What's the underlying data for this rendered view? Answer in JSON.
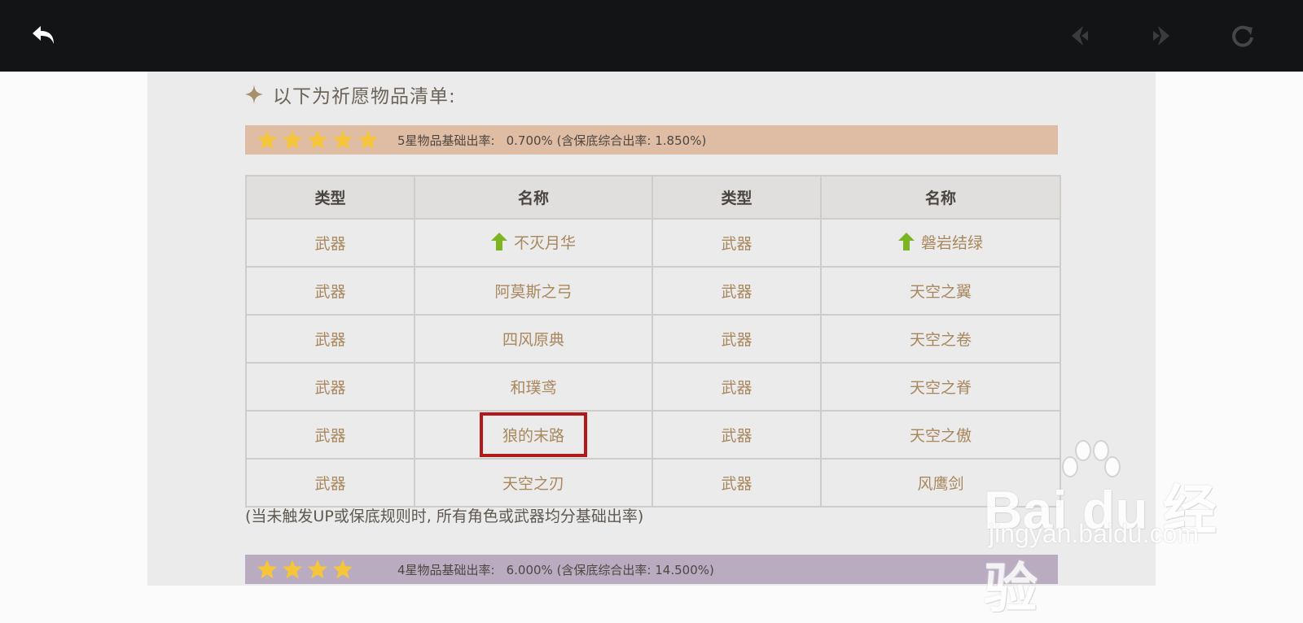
{
  "toolbar": {
    "back_icon": "back-arrow-icon",
    "prev_icon": "prev-arrow-icon",
    "next_icon": "next-arrow-icon",
    "reload_icon": "reload-icon"
  },
  "section": {
    "heading": "以下为祈愿物品清单:"
  },
  "five_star": {
    "stars": 5,
    "label": "5星物品基础出率:",
    "rate": "0.700% (含保底综合出率: 1.850%)"
  },
  "table": {
    "headers": [
      "类型",
      "名称",
      "类型",
      "名称"
    ],
    "rows": [
      {
        "type1": "武器",
        "name1": "不灭月华",
        "up1": true,
        "type2": "武器",
        "name2": "磐岩结绿",
        "up2": true
      },
      {
        "type1": "武器",
        "name1": "阿莫斯之弓",
        "type2": "武器",
        "name2": "天空之翼"
      },
      {
        "type1": "武器",
        "name1": "四风原典",
        "type2": "武器",
        "name2": "天空之卷"
      },
      {
        "type1": "武器",
        "name1": "和璞鸢",
        "type2": "武器",
        "name2": "天空之脊"
      },
      {
        "type1": "武器",
        "name1": "狼的末路",
        "type2": "武器",
        "name2": "天空之傲"
      },
      {
        "type1": "武器",
        "name1": "天空之刃",
        "type2": "武器",
        "name2": "风鹰剑"
      }
    ]
  },
  "note": "(当未触发UP或保底规则时, 所有角色或武器均分基础出率)",
  "four_star": {
    "stars": 4,
    "label": "4星物品基础出率:",
    "rate": "6.000% (含保底综合出率: 14.500%)"
  },
  "watermark": {
    "brand": "Bai du 经验",
    "url": "jingyan.baidu.com"
  },
  "colors": {
    "topbar": "#131416",
    "panel": "#ebebeb",
    "five_star_bar": "#dfbca4",
    "four_star_bar": "#b9acc1",
    "item_text": "#a8875c",
    "highlight": "#b2191b",
    "star": "#f6c53a",
    "up_arrow": "#7cb51f"
  }
}
